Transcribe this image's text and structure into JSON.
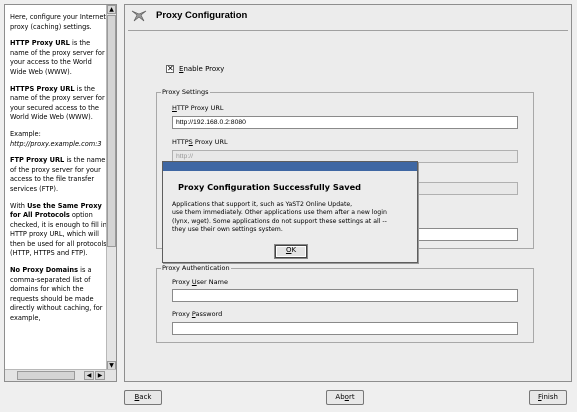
{
  "help": {
    "p1": "Here, configure your Internet proxy (caching) settings.",
    "p2_bold": "HTTP Proxy URL",
    "p2_rest": " is the name of the proxy server for your access to the World Wide Web (WWW).",
    "p3_bold": "HTTPS Proxy URL",
    "p3_rest": " is the name of the proxy server for your secured access to the World Wide Web (WWW).",
    "p4": "Example:",
    "p4_em": "http://proxy.example.com:3",
    "p5_bold": "FTP Proxy URL",
    "p5_rest": " is the name of the proxy server for your access to the file transfer services (FTP).",
    "p6_pre": "With ",
    "p6_bold": "Use the Same Proxy for All Protocols",
    "p6_rest": " option checked, it is enough to fill in HTTP proxy URL, which will then be used for all protocols (HTTP, HTTPS and FTP).",
    "p7_bold": "No Proxy Domains",
    "p7_rest": " is a comma-separated list of domains for which the requests should be made directly without caching, for example,"
  },
  "main": {
    "title": "Proxy Configuration",
    "enable_proxy": {
      "label": "Enable Proxy",
      "checked": true
    },
    "proxy_settings": {
      "title": "Proxy Settings",
      "http_label": "HTTP Proxy URL",
      "http_value": "http://192.168.0.2:8080",
      "https_label": "HTTPS Proxy URL",
      "https_value": "http://"
    },
    "proxy_auth": {
      "title": "Proxy Authentication",
      "user_label": "Proxy User Name",
      "user_value": "",
      "password_label": "Proxy Password",
      "password_value": ""
    }
  },
  "dialog": {
    "title": "Proxy Configuration Successfully Saved",
    "line1": "Applications that support it, such as YaST2 Online Update,",
    "line2": "use them immediately. Other applications use them after a new login",
    "line3": "(lynx, wget). Some applications do not support these settings at all --",
    "line4": "they use their own settings system.",
    "ok": "OK"
  },
  "buttons": {
    "back": "Back",
    "abort": "Abort",
    "finish": "Finish"
  },
  "colors": {
    "dialog_bar": "#3f67a3"
  }
}
